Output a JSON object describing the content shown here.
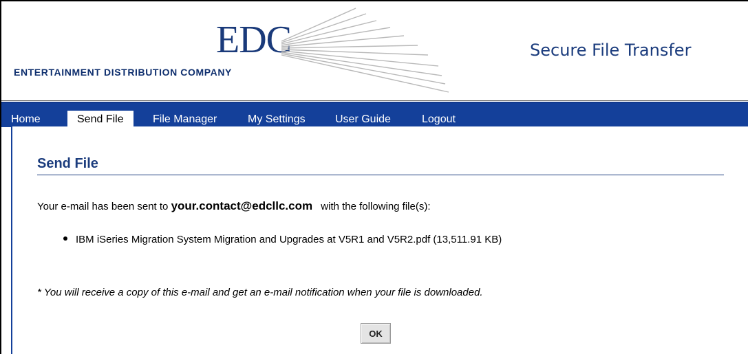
{
  "header": {
    "logo_mark": "EDC",
    "company_name": "ENTERTAINMENT DISTRIBUTION COMPANY",
    "app_title": "Secure File Transfer"
  },
  "nav": {
    "items": [
      {
        "label": "Home",
        "active": false
      },
      {
        "label": "Send File",
        "active": true
      },
      {
        "label": "File Manager",
        "active": false
      },
      {
        "label": "My Settings",
        "active": false
      },
      {
        "label": "User Guide",
        "active": false
      },
      {
        "label": "Logout",
        "active": false
      }
    ]
  },
  "main": {
    "heading": "Send File",
    "message_prefix": "Your e-mail has been sent to",
    "recipient": "your.contact@edcllc.com",
    "message_suffix": "with the following file(s):",
    "files": [
      "IBM iSeries Migration System Migration and Upgrades at V5R1 and V5R2.pdf (13,511.91 KB)"
    ],
    "note": "* You will receive a copy of this e-mail and get an e-mail notification when your file is downloaded.",
    "ok_label": "OK"
  },
  "colors": {
    "brand_blue": "#14409a",
    "heading_blue": "#1b3c7d",
    "logo_blue": "#1a3a7a"
  }
}
